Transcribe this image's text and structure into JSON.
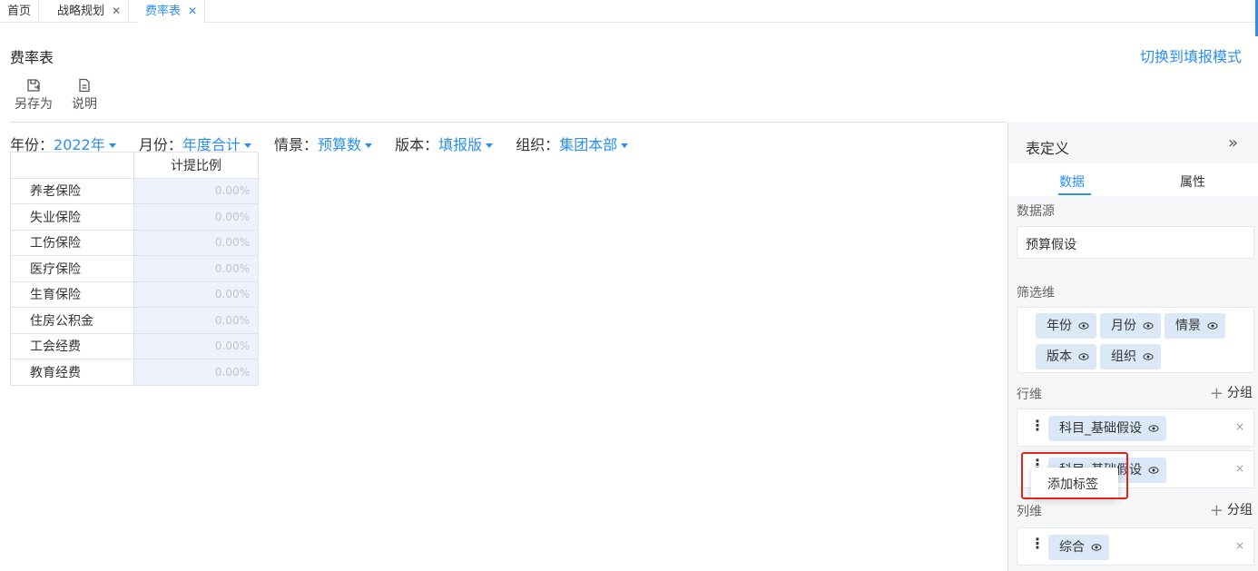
{
  "tabs": [
    {
      "label": "首页",
      "closable": false,
      "active": false
    },
    {
      "label": "战略规划",
      "closable": true,
      "active": false
    },
    {
      "label": "费率表",
      "closable": true,
      "active": true
    }
  ],
  "tab_close_glyph": "✕",
  "page": {
    "title": "费率表",
    "switch_mode_label": "切换到填报模式"
  },
  "toolbar": {
    "save_as_label": "另存为",
    "explain_label": "说明",
    "save_as_icon": "save-as-icon",
    "explain_icon": "document-icon"
  },
  "filters": [
    {
      "label": "年份：",
      "value": "2022年"
    },
    {
      "label": "月份：",
      "value": "年度合计"
    },
    {
      "label": "情景：",
      "value": "预算数"
    },
    {
      "label": "版本：",
      "value": "填报版"
    },
    {
      "label": "组织：",
      "value": "集团本部"
    }
  ],
  "grid": {
    "column_header": "计提比例",
    "rows": [
      {
        "label": "养老保险",
        "value": "0.00%"
      },
      {
        "label": "失业保险",
        "value": "0.00%"
      },
      {
        "label": "工伤保险",
        "value": "0.00%"
      },
      {
        "label": "医疗保险",
        "value": "0.00%"
      },
      {
        "label": "生育保险",
        "value": "0.00%"
      },
      {
        "label": "住房公积金",
        "value": "0.00%"
      },
      {
        "label": "工会经费",
        "value": "0.00%"
      },
      {
        "label": "教育经费",
        "value": "0.00%"
      }
    ]
  },
  "panel": {
    "title": "表定义",
    "collapse_glyph": "»",
    "tabs": {
      "data": "数据",
      "attr": "属性"
    },
    "datasource_label": "数据源",
    "datasource_value": "预算假设",
    "filter_dims_label": "筛选维",
    "filter_dims": [
      "年份",
      "月份",
      "情景",
      "版本",
      "组织"
    ],
    "row_dims_label": "行维",
    "add_group_label": "分组",
    "row_dims": [
      "科目_基础假设",
      "科目_基础假设"
    ],
    "col_dims_label": "列维",
    "col_dims": [
      "综合"
    ],
    "handle_glyph": "⋮",
    "remove_glyph": "×"
  },
  "context_menu": {
    "items": [
      "添加标签"
    ]
  },
  "colors": {
    "accent": "#2b8ff0",
    "chip_bg": "#dbe8f8",
    "cell_bg": "#eef2fc",
    "highlight": "#e3231b"
  }
}
